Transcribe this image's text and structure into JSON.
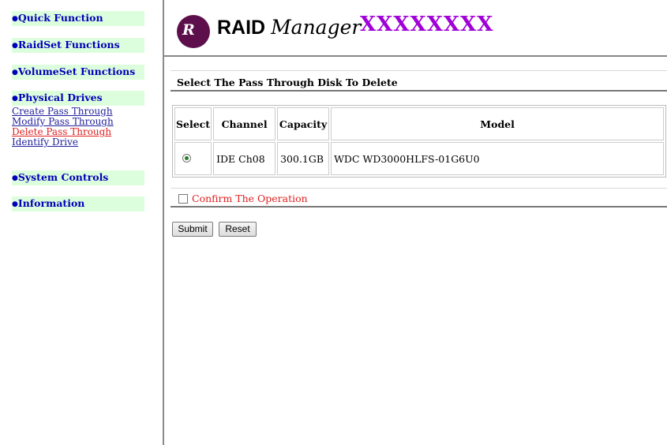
{
  "sidebar": {
    "quick_function": "Quick Function",
    "raidset_functions": "RaidSet Functions",
    "volumeset_functions": "VolumeSet Functions",
    "physical_drives": "Physical Drives",
    "physical_drive_links": [
      "Create Pass Through",
      "Modify Pass Through",
      "Delete Pass Through",
      "Identify Drive"
    ],
    "active_link": "Delete Pass Through",
    "system_controls": "System Controls",
    "information": "Information"
  },
  "header": {
    "logo_initials": "R",
    "logo_text_raid": "RAID",
    "logo_text_manager": "Manager",
    "model_name": "XXXXXXXX"
  },
  "main": {
    "section_title": "Select The Pass Through Disk To Delete",
    "table": {
      "headers": [
        "Select",
        "Channel",
        "Capacity",
        "Model"
      ],
      "rows": [
        {
          "selected": true,
          "channel": "IDE Ch08",
          "capacity": "300.1GB",
          "model": "WDC WD3000HLFS-01G6U0"
        }
      ]
    },
    "confirm_label": "Confirm The Operation",
    "confirm_checked": false,
    "submit_label": "Submit",
    "reset_label": "Reset"
  },
  "colors": {
    "section_bg": "#ddfedd",
    "section_text": "#0000b8",
    "active_link": "#e02020",
    "model_name": "#a000d8",
    "logo_circle": "#5c0f4a"
  }
}
